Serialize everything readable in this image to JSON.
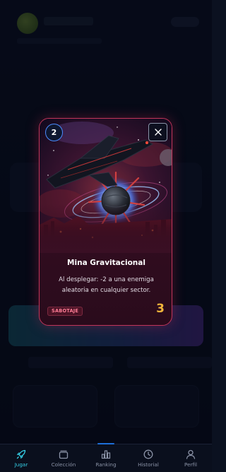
{
  "card": {
    "cost": "2",
    "name": "Mina Gravitacional",
    "description": "Al desplegar: -2 a una enemiga aleatoria en cualquier sector.",
    "tag": "SABOTAJE",
    "power": "3",
    "close_icon": "close-icon",
    "colors": {
      "border": "#c0355a",
      "tag_text": "#ff7c95",
      "power": "#f1b53b",
      "cost_ring": "#4b8cff"
    }
  },
  "nav": {
    "items": [
      {
        "label": "Jugar",
        "icon": "rocket-icon",
        "active": true
      },
      {
        "label": "Colección",
        "icon": "cards-icon",
        "active": false
      },
      {
        "label": "Ranking",
        "icon": "bar-chart-icon",
        "active": false
      },
      {
        "label": "Historial",
        "icon": "clock-icon",
        "active": false
      },
      {
        "label": "Perfil",
        "icon": "user-icon",
        "active": false
      }
    ],
    "active_color": "#35d1e8",
    "inactive_color": "#8b93a7"
  }
}
